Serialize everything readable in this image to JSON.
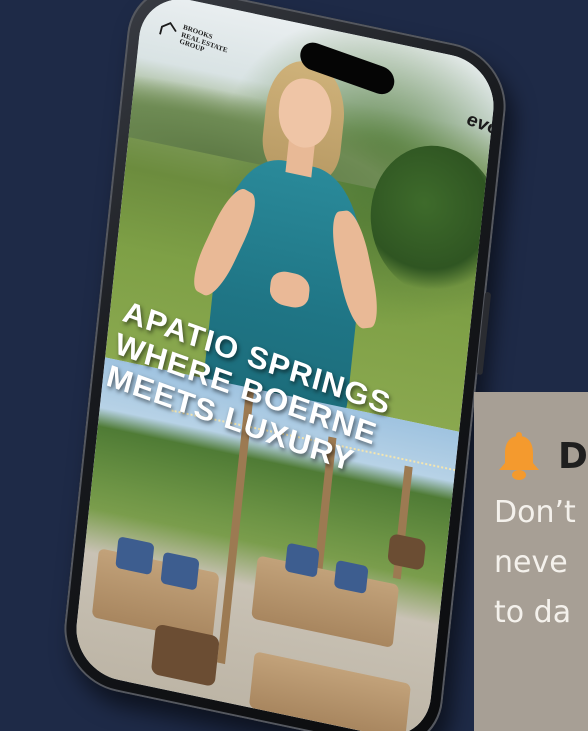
{
  "phone_screen": {
    "logo_text": [
      "BROOKS",
      "REAL ESTATE",
      "GROUP"
    ],
    "brand_partial": "evo",
    "headline": [
      "APATIO SPRINGS",
      "WHERE BOERNE",
      "MEETS LUXURY"
    ]
  },
  "notice": {
    "icon": "bell-icon",
    "title": "D",
    "body_lines": [
      "Don’t",
      "neve",
      "to da"
    ],
    "accent_color": "#f49a2e",
    "background_color": "#a79f95"
  },
  "colors": {
    "page_background": "#1e2a47"
  }
}
